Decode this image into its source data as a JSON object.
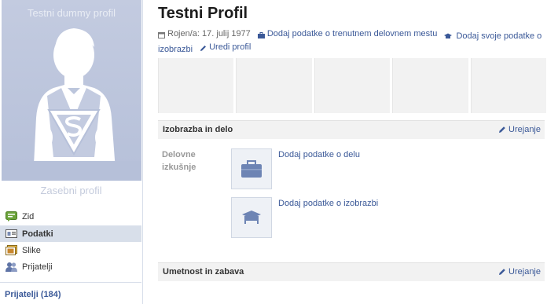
{
  "sidebar": {
    "pic_caption": "Testni dummy profil",
    "pic_subcaption": "Zasebni profil",
    "items": [
      {
        "label": "Zid",
        "icon": "wall-icon"
      },
      {
        "label": "Podatki",
        "icon": "info-icon",
        "active": true
      },
      {
        "label": "Slike",
        "icon": "photos-icon"
      },
      {
        "label": "Prijatelji",
        "icon": "friends-icon"
      }
    ],
    "friends_link": "Prijatelji (184)"
  },
  "profile": {
    "name": "Testni Profil",
    "birthday": "Rojen/a: 17. julij 1977",
    "add_work": "Dodaj podatke o trenutnem delovnem mestu",
    "add_education": "Dodaj svoje podatke o izobrazbi",
    "edit_profile": "Uredi profil"
  },
  "sections": {
    "education": {
      "title": "Izobrazba in delo",
      "edit": "Urejanje",
      "work_label": "Delovne izkušnje",
      "add_job": "Dodaj podatke o delu",
      "add_school": "Dodaj podatke o izobrazbi"
    },
    "arts": {
      "title": "Umetnost in zabava",
      "edit": "Urejanje"
    }
  },
  "colors": {
    "link": "#3b5998",
    "sidebar_active": "#d8dfea",
    "silhouette_bg": "#b6c0d9"
  }
}
